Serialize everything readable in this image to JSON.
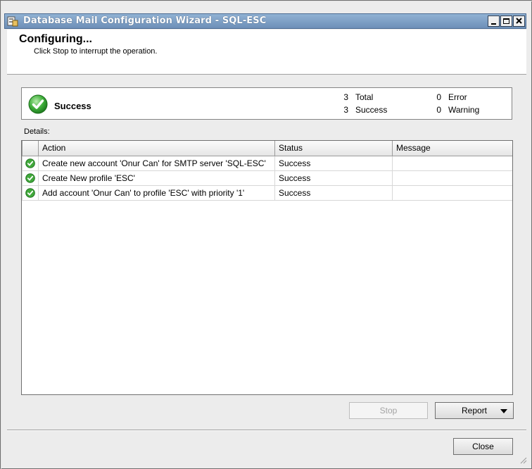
{
  "window": {
    "title": "Database Mail Configuration Wizard - SQL-ESC",
    "controls": {
      "minimize": "minimize-icon",
      "maximize": "maximize-icon",
      "close": "close-icon"
    }
  },
  "header": {
    "title": "Configuring...",
    "subtitle": "Click Stop to interrupt the operation."
  },
  "summary": {
    "status": "Success",
    "total_count": "3",
    "total_label": "Total",
    "success_count": "3",
    "success_label": "Success",
    "error_count": "0",
    "error_label": "Error",
    "warning_count": "0",
    "warning_label": "Warning"
  },
  "details": {
    "label": "Details:",
    "columns": [
      "Action",
      "Status",
      "Message"
    ],
    "rows": [
      {
        "action": "Create new account 'Onur Can' for SMTP server 'SQL-ESC'",
        "status": "Success",
        "message": ""
      },
      {
        "action": "Create New profile 'ESC'",
        "status": "Success",
        "message": ""
      },
      {
        "action": "Add account 'Onur Can' to profile 'ESC' with priority '1'",
        "status": "Success",
        "message": ""
      }
    ]
  },
  "buttons": {
    "stop": "Stop",
    "report": "Report",
    "close": "Close"
  },
  "colors": {
    "titlebar": "#6d8fb8",
    "success_green": "#3aa33a"
  }
}
